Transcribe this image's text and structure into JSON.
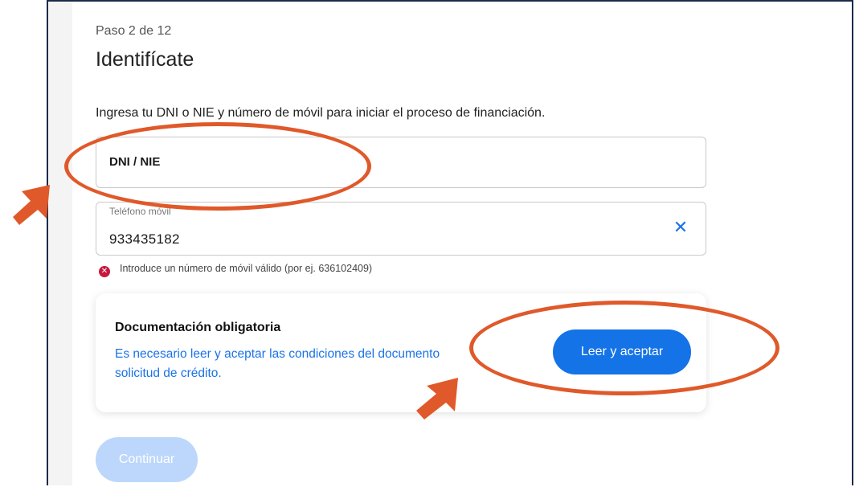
{
  "step": "Paso 2 de 12",
  "title": "Identifícate",
  "intro": "Ingresa tu DNI o NIE y número de móvil para iniciar el proceso de financiación.",
  "dni_field": {
    "value": "DNI / NIE"
  },
  "phone_field": {
    "label": "Teléfono móvil",
    "value": "933435182",
    "clear_icon": "close-icon"
  },
  "error": {
    "icon": "error-x-icon",
    "text": "Introduce un número de móvil válido (por ej. 636102409)"
  },
  "documentation": {
    "title": "Documentación obligatoria",
    "description": "Es necesario leer y aceptar las condiciones del documento solicitud de crédito.",
    "button_label": "Leer y aceptar"
  },
  "continue_label": "Continuar",
  "colors": {
    "accent": "#1473e6",
    "link": "#1a73e8",
    "error": "#c8193c",
    "annotation": "#e0592a",
    "disabled_button": "#bcd7fb"
  }
}
